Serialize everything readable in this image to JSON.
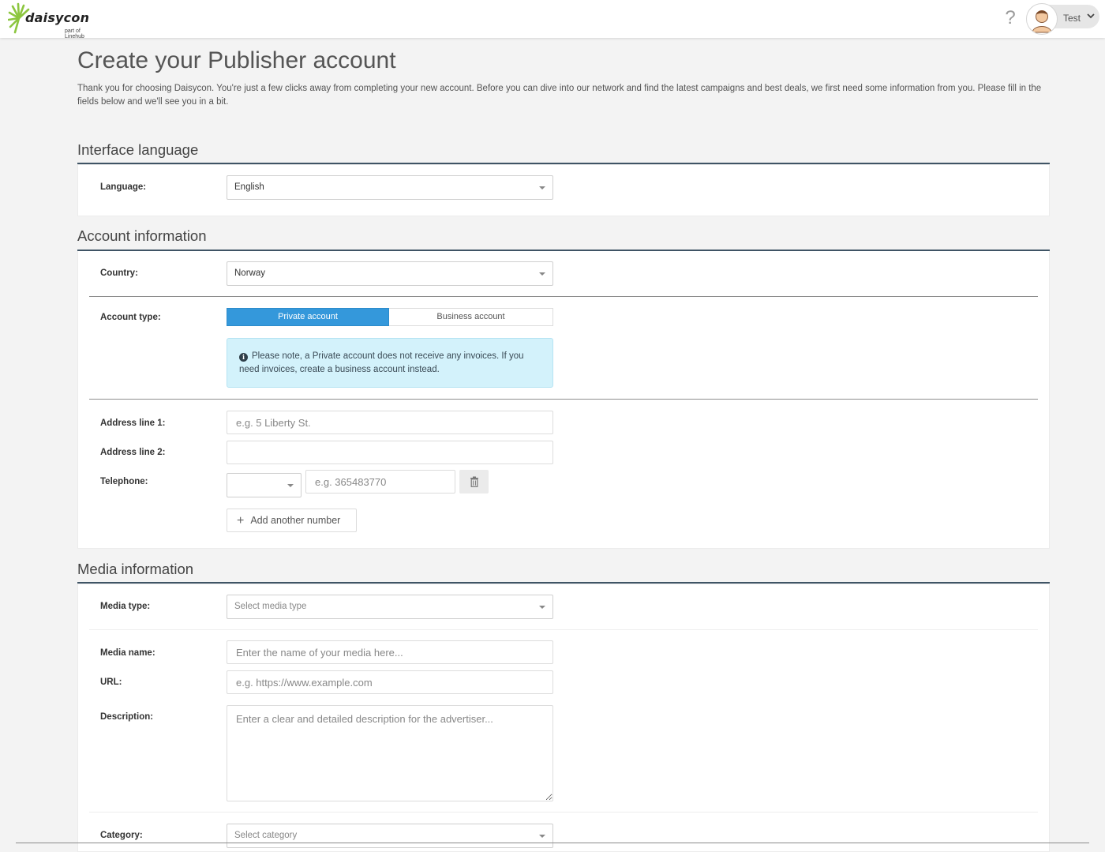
{
  "header": {
    "logo_text": "daisycon",
    "logo_subtext": "part of Linehub",
    "help_label": "?",
    "user_name": "Test"
  },
  "page": {
    "title": "Create your Publisher account",
    "intro": "Thank you for choosing Daisycon. You're just a few clicks away from completing your new account. Before you can dive into our network and find the latest campaigns and best deals, we first need some information from you. Please fill in the fields below and we'll see you in a bit."
  },
  "interface_language": {
    "title": "Interface language",
    "language_label": "Language:",
    "language_value": "English"
  },
  "account_information": {
    "title": "Account information",
    "country_label": "Country:",
    "country_value": "Norway",
    "account_type_label": "Account type:",
    "account_type_options": [
      "Private account",
      "Business account"
    ],
    "account_type_selected": "Private account",
    "private_note": "Please note, a Private account does not receive any invoices. If you need invoices, create a business account instead.",
    "address1_label": "Address line 1:",
    "address1_placeholder": "e.g. 5 Liberty St.",
    "address2_label": "Address line 2:",
    "address2_placeholder": "",
    "telephone_label": "Telephone:",
    "telephone_code_value": "",
    "telephone_placeholder": "e.g. 365483770",
    "add_number_label": "Add another number"
  },
  "media_information": {
    "title": "Media information",
    "media_type_label": "Media type:",
    "media_type_placeholder": "Select media type",
    "media_name_label": "Media name:",
    "media_name_placeholder": "Enter the name of your media here...",
    "url_label": "URL:",
    "url_placeholder": "e.g. https://www.example.com",
    "description_label": "Description:",
    "description_placeholder": "Enter a clear and detailed description for the advertiser...",
    "category_label": "Category:",
    "category_placeholder": "Select category"
  },
  "colors": {
    "accent": "#3498db",
    "section_rule": "#3f5465",
    "info_background": "#d3f2fb",
    "page_background": "#f3f3f3"
  },
  "icons": [
    "daisy-logo-icon",
    "help-icon",
    "avatar-icon",
    "chevron-down-icon",
    "info-icon",
    "trash-icon",
    "plus-icon",
    "caret-down-icon"
  ]
}
